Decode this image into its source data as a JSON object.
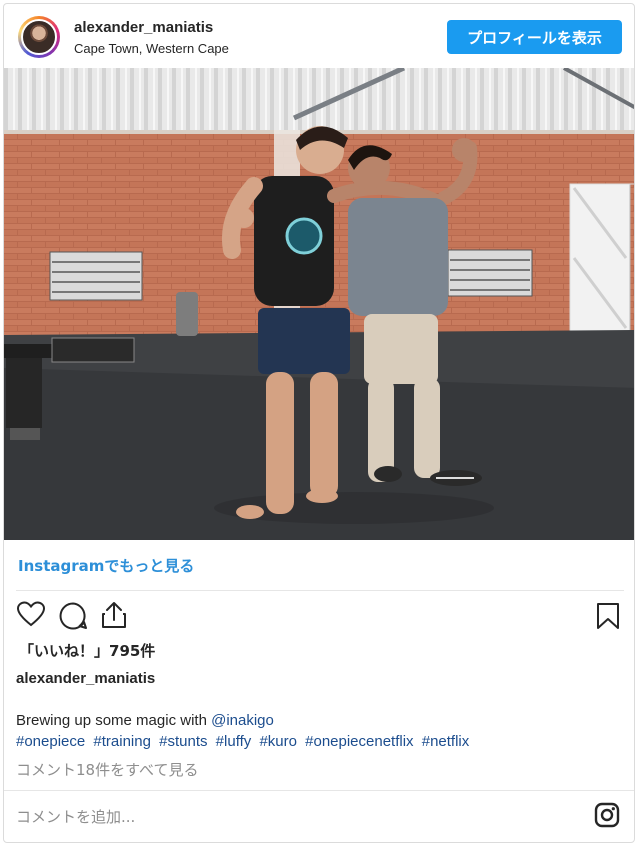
{
  "header": {
    "username": "alexander_maniatis",
    "location": "Cape Town, Western Cape",
    "profile_button": "プロフィールを表示"
  },
  "post": {
    "image_icon": "photo",
    "more_link": "Instagramでもっと見る",
    "likes": "「いいね！」795件",
    "caption_username": "alexander_maniatis",
    "caption_text": "Brewing up some magic with ",
    "mention": "@inakigo",
    "hashtags": [
      "#onepiece",
      "#training",
      "#stunts",
      "#luffy",
      "#kuro",
      "#onepiecenetflix",
      "#netflix"
    ],
    "comments_link": "コメント18件をすべて見る",
    "comment_placeholder": "コメントを追加..."
  },
  "icons": {
    "like": "heart-icon",
    "comment": "comment-icon",
    "share": "share-icon",
    "save": "bookmark-icon",
    "instagram": "instagram-icon"
  },
  "colors": {
    "button_blue": "#1a9bf0",
    "link_blue": "#2d8fd8",
    "hashtag_blue": "#1c4d8e"
  }
}
